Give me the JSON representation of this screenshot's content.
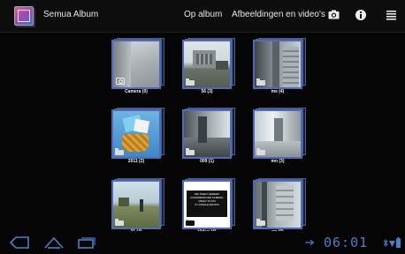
{
  "actionbar": {
    "title": "Semua Album",
    "tab_album": "Op album",
    "tab_media": "Afbeeldingen en video's",
    "camera_icon": "camera-icon",
    "info_icon": "info-icon",
    "menu_icon": "menu-icon"
  },
  "albums": [
    {
      "label": "Camera (0)"
    },
    {
      "label": "56 (3)"
    },
    {
      "label": "me (4)"
    },
    {
      "label": "2011 (2)"
    },
    {
      "label": "009 (1)"
    },
    {
      "label": "mn (3)"
    },
    {
      "label": "21 (4)"
    },
    {
      "label": "Video (4)"
    },
    {
      "label": "pp (0)"
    }
  ],
  "video_thumb_text": "WE VIDEO HEREOF\nDAPHNEMAUDE KAMERA\nVIDEO TO DO\nIN JUNGLE BOOKS",
  "sysbar": {
    "clock": "06:01",
    "back_icon": "back-icon",
    "home_icon": "home-icon",
    "recent_icon": "recent-apps-icon"
  },
  "colors": {
    "accent": "#4f6bb8",
    "clock": "#4e7ec7"
  }
}
